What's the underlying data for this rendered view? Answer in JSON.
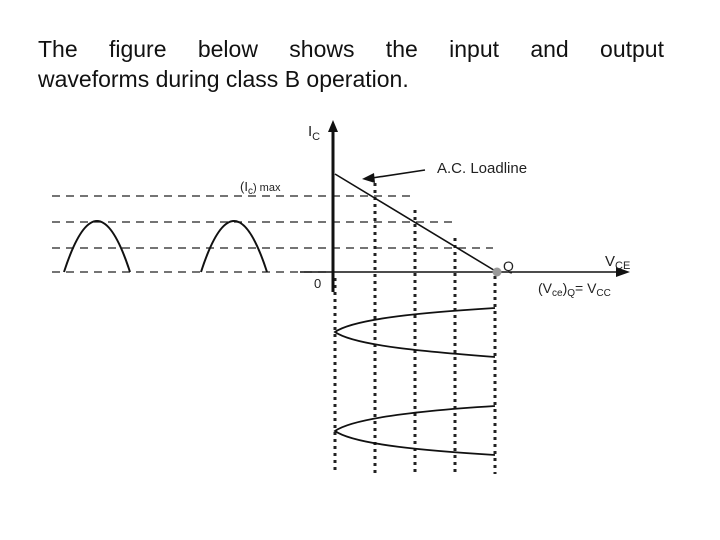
{
  "description": {
    "line1": "The figure below shows the input and output",
    "line2": "waveforms during class B operation."
  },
  "diagram": {
    "y_axis_label": "I",
    "y_axis_sub": "C",
    "x_axis_label": "V",
    "x_axis_sub": "CE",
    "origin_label": "0",
    "ic_max_label": "(I",
    "ic_max_sub": "c",
    "ic_max_suffix": ") max",
    "loadline_label": "A.C. Loadline",
    "q_point_label": "Q",
    "vce_q_label_pre": "(V",
    "vce_q_sub1": "ce",
    "vce_q_mid": ")",
    "vce_q_sub2": "Q",
    "vce_q_eq": "= V",
    "vce_q_sub3": "CC",
    "input_waveform": "half-wave pulses (2 cycles)",
    "output_waveform": "half-sine collector voltage swings (2 cycles)"
  }
}
